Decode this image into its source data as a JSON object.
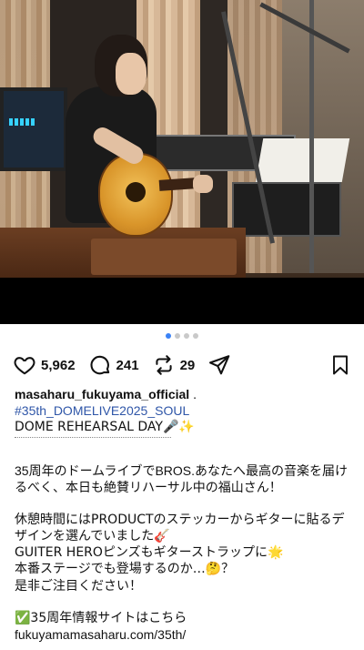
{
  "post": {
    "likes": "5,962",
    "comments": "241",
    "reposts": "29",
    "carousel": {
      "count": 4,
      "active_index": 0
    }
  },
  "caption": {
    "username": "masaharu_fukuyama_official",
    "username_suffix": " .",
    "hashtag": "#35th_DOMELIVE2025_SOUL",
    "headline": "DOME REHEARSAL DAY🎤✨",
    "paragraph1": "35周年のドームライブでBROS.あなたへ最高の音楽を届けるべく、本日も絶賛リハーサル中の福山さん！",
    "p2_line1": "休憩時間にはPRODUCTのステッカーからギターに貼るデザインを選んでいました🎸",
    "p2_line2": "GUITER HEROピンズもギターストラップに🌟",
    "p2_line3": "本番ステージでも登場するのか…🤔？",
    "p2_line4": "是非ご注目ください！",
    "link_intro": "✅35周年情報サイトはこちら",
    "link_url": "fukuyamamasaharu.com/35th/"
  },
  "colors": {
    "accent_blue": "#3b82f6",
    "hashtag": "#2f56a8",
    "text": "#111111"
  },
  "icons": [
    "heart-icon",
    "comment-icon",
    "repost-icon",
    "share-icon",
    "bookmark-icon"
  ]
}
